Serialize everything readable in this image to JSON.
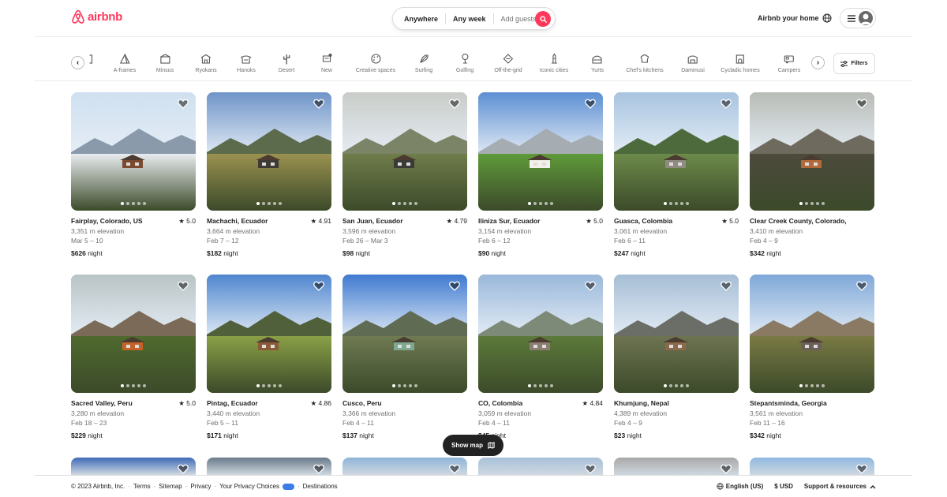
{
  "header": {
    "logo_text": "airbnb",
    "search": {
      "anywhere": "Anywhere",
      "anyweek": "Any week",
      "guests": "Add guests"
    },
    "host_label": "Airbnb your home"
  },
  "categories": [
    {
      "label": "A-frames",
      "icon": "a-frame-icon"
    },
    {
      "label": "Minsus",
      "icon": "minsus-icon"
    },
    {
      "label": "Ryokans",
      "icon": "ryokan-icon"
    },
    {
      "label": "Hanoks",
      "icon": "hanok-icon"
    },
    {
      "label": "Desert",
      "icon": "cactus-icon"
    },
    {
      "label": "New",
      "icon": "new-icon"
    },
    {
      "label": "Creative spaces",
      "icon": "palette-icon"
    },
    {
      "label": "Surfing",
      "icon": "surfboard-icon"
    },
    {
      "label": "Golfing",
      "icon": "golf-icon"
    },
    {
      "label": "Off-the-grid",
      "icon": "off-grid-icon"
    },
    {
      "label": "Iconic cities",
      "icon": "tower-icon"
    },
    {
      "label": "Yurts",
      "icon": "yurt-icon"
    },
    {
      "label": "Chef's kitchens",
      "icon": "chef-hat-icon"
    },
    {
      "label": "Dammusi",
      "icon": "dammuso-icon"
    },
    {
      "label": "Cycladic homes",
      "icon": "cycladic-home-icon"
    },
    {
      "label": "Campers",
      "icon": "camper-icon"
    }
  ],
  "filters_label": "Filters",
  "listings": [
    {
      "location": "Fairplay, Colorado, US",
      "rating": "★ 5.0",
      "elevation": "3,351 m elevation",
      "dates": "Mar 5 – 10",
      "price": "$626",
      "price_unit": " night",
      "sky": "#cfe0f0",
      "mountain": "#8a9aab",
      "land": "#e8ecef",
      "house": "#7b4b2f"
    },
    {
      "location": "Machachi, Ecuador",
      "rating": "★ 4.91",
      "elevation": "3,664 m elevation",
      "dates": "Feb 7 – 12",
      "price": "$182",
      "price_unit": " night",
      "sky": "#6f94c8",
      "mountain": "#5b6b4c",
      "land": "#9a9250",
      "house": "#3e3a34"
    },
    {
      "location": "San Juan, Ecuador",
      "rating": "★ 4.79",
      "elevation": "3,596 m elevation",
      "dates": "Feb 26 – Mar 3",
      "price": "$98",
      "price_unit": " night",
      "sky": "#c9ccc8",
      "mountain": "#7b8466",
      "land": "#6f7c4a",
      "house": "#3a3a36"
    },
    {
      "location": "Iliniza Sur, Ecuador",
      "rating": "★ 5.0",
      "elevation": "3,154 m elevation",
      "dates": "Feb 6 – 12",
      "price": "$90",
      "price_unit": " night",
      "sky": "#5d8fd3",
      "mountain": "#a6adb2",
      "land": "#5f9a3a",
      "house": "#f2f0ea"
    },
    {
      "location": "Guasca, Colombia",
      "rating": "★ 5.0",
      "elevation": "3,061 m elevation",
      "dates": "Feb 6 – 11",
      "price": "$247",
      "price_unit": " night",
      "sky": "#a8c4e0",
      "mountain": "#4d6a3c",
      "land": "#6c8a4a",
      "house": "#8f8b80"
    },
    {
      "location": "Clear Creek County, Colorado, US",
      "rating": "",
      "elevation": "3,410 m elevation",
      "dates": "Feb 4 – 9",
      "price": "$342",
      "price_unit": " night",
      "sky": "#b8bcb6",
      "mountain": "#6f6a5e",
      "land": "#4c4a3c",
      "house": "#b36a3a"
    },
    {
      "location": "Sacred Valley, Peru",
      "rating": "★ 5.0",
      "elevation": "3,280 m elevation",
      "dates": "Feb 18 – 23",
      "price": "$229",
      "price_unit": " night",
      "sky": "#b9c4c6",
      "mountain": "#7b6a58",
      "land": "#4f6a2e",
      "house": "#c4622a"
    },
    {
      "location": "Pintag, Ecuador",
      "rating": "★ 4.86",
      "elevation": "3,440 m elevation",
      "dates": "Feb 5 – 11",
      "price": "$171",
      "price_unit": " night",
      "sky": "#4f86cf",
      "mountain": "#50603a",
      "land": "#8aa046",
      "house": "#8a5a36"
    },
    {
      "location": "Cusco, Peru",
      "rating": "",
      "elevation": "3,366 m elevation",
      "dates": "Feb 4 – 11",
      "price": "$137",
      "price_unit": " night",
      "sky": "#3f7ad0",
      "mountain": "#5f6b52",
      "land": "#6f7a52",
      "house": "#7fa890"
    },
    {
      "location": "CO, Colombia",
      "rating": "★ 4.84",
      "elevation": "3,059 m elevation",
      "dates": "Feb 4 – 11",
      "price": "$45",
      "price_unit": " night",
      "sky": "#9ab8da",
      "mountain": "#7d8a78",
      "land": "#5c7a3a",
      "house": "#8a7e70"
    },
    {
      "location": "Khumjung, Nepal",
      "rating": "",
      "elevation": "4,389 m elevation",
      "dates": "Feb 4 – 9",
      "price": "$23",
      "price_unit": " night",
      "sky": "#a6bed6",
      "mountain": "#6a6e66",
      "land": "#6e7452",
      "house": "#8a6a4a"
    },
    {
      "location": "Stepantsminda, Georgia",
      "rating": "",
      "elevation": "3,561 m elevation",
      "dates": "Feb 11 – 16",
      "price": "$342",
      "price_unit": " night",
      "sky": "#7fa8d8",
      "mountain": "#8a7a64",
      "land": "#7a7a44",
      "house": "#6a6058"
    }
  ],
  "peek_colors": [
    "#3f6bb8",
    "#6a7a8a",
    "#8fb4d8",
    "#a8c0d8",
    "#a8a8a8",
    "#8fb8e0"
  ],
  "show_map_label": "Show map",
  "footer": {
    "copyright": "© 2023 Airbnb, Inc.",
    "terms": "Terms",
    "sitemap": "Sitemap",
    "privacy": "Privacy",
    "privacy_choices": "Your Privacy Choices",
    "destinations": "Destinations",
    "language": "English (US)",
    "currency": "$  USD",
    "support": "Support & resources"
  }
}
